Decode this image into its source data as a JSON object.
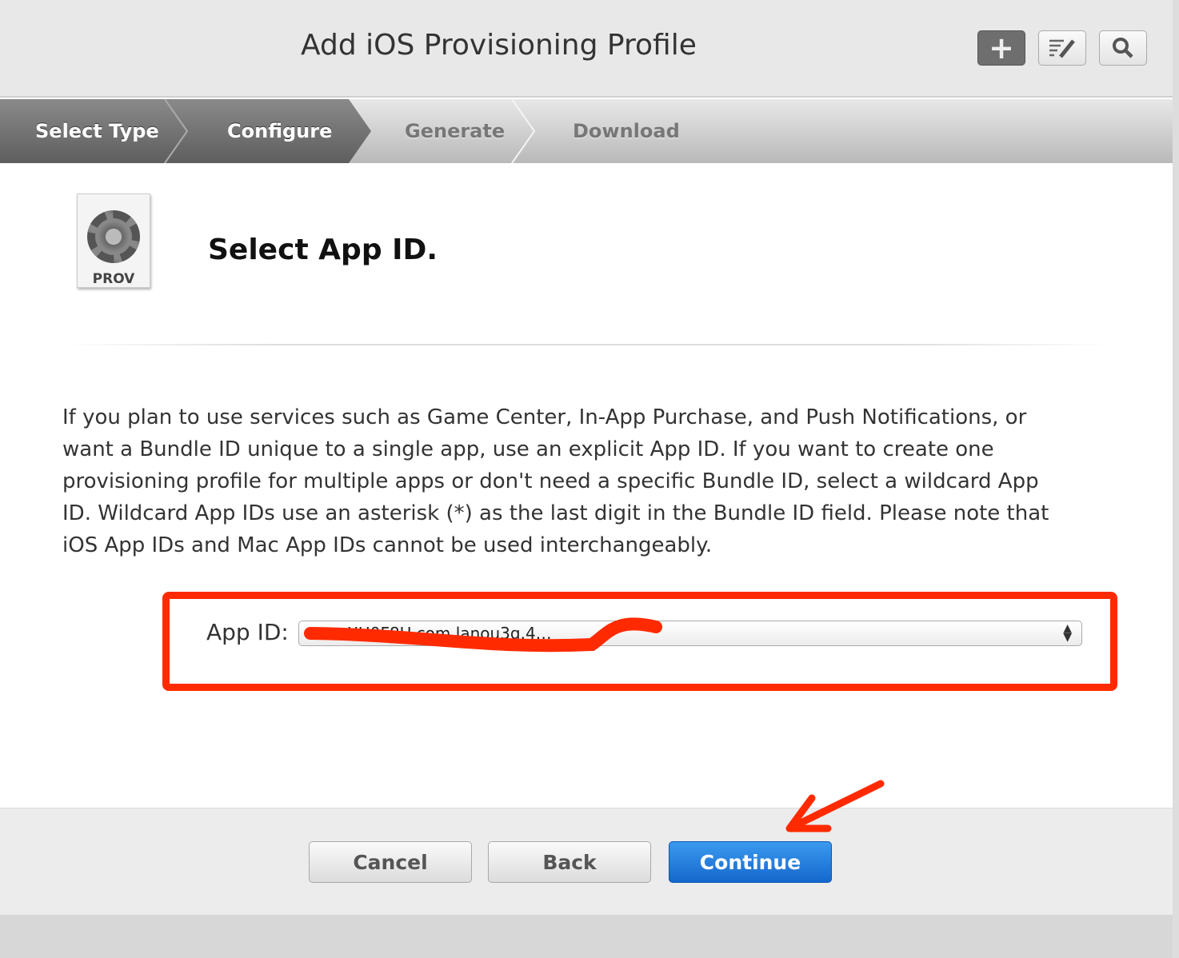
{
  "header": {
    "title": "Add iOS Provisioning Profile",
    "buttons": [
      {
        "icon": "plus-icon"
      },
      {
        "icon": "edit-list-icon"
      },
      {
        "icon": "search-icon"
      }
    ]
  },
  "steps": [
    {
      "label": "Select Type",
      "state": "done"
    },
    {
      "label": "Configure",
      "state": "current"
    },
    {
      "label": "Generate",
      "state": "todo"
    },
    {
      "label": "Download",
      "state": "todo"
    }
  ],
  "content": {
    "icon_label": "PROV",
    "heading": "Select App ID.",
    "description": "If you plan to use services such as Game Center, In-App Purchase, and Push Notifications, or want a Bundle ID unique to a single app, use an explicit App ID. If you want to create one provisioning profile for multiple apps or don't need a specific Bundle ID, select a wildcard App ID. Wildcard App IDs use an asterisk (*) as the last digit in the Bundle ID field. Please note that iOS App IDs and Mac App IDs cannot be used interchangeably.",
    "app_id_label": "App ID:",
    "app_id_value": "…XH0F8U.com.lanou3g.4…"
  },
  "footer": {
    "cancel": "Cancel",
    "back": "Back",
    "continue": "Continue"
  },
  "colors": {
    "annotation": "#ff2a00",
    "primary": "#1a73d6"
  }
}
